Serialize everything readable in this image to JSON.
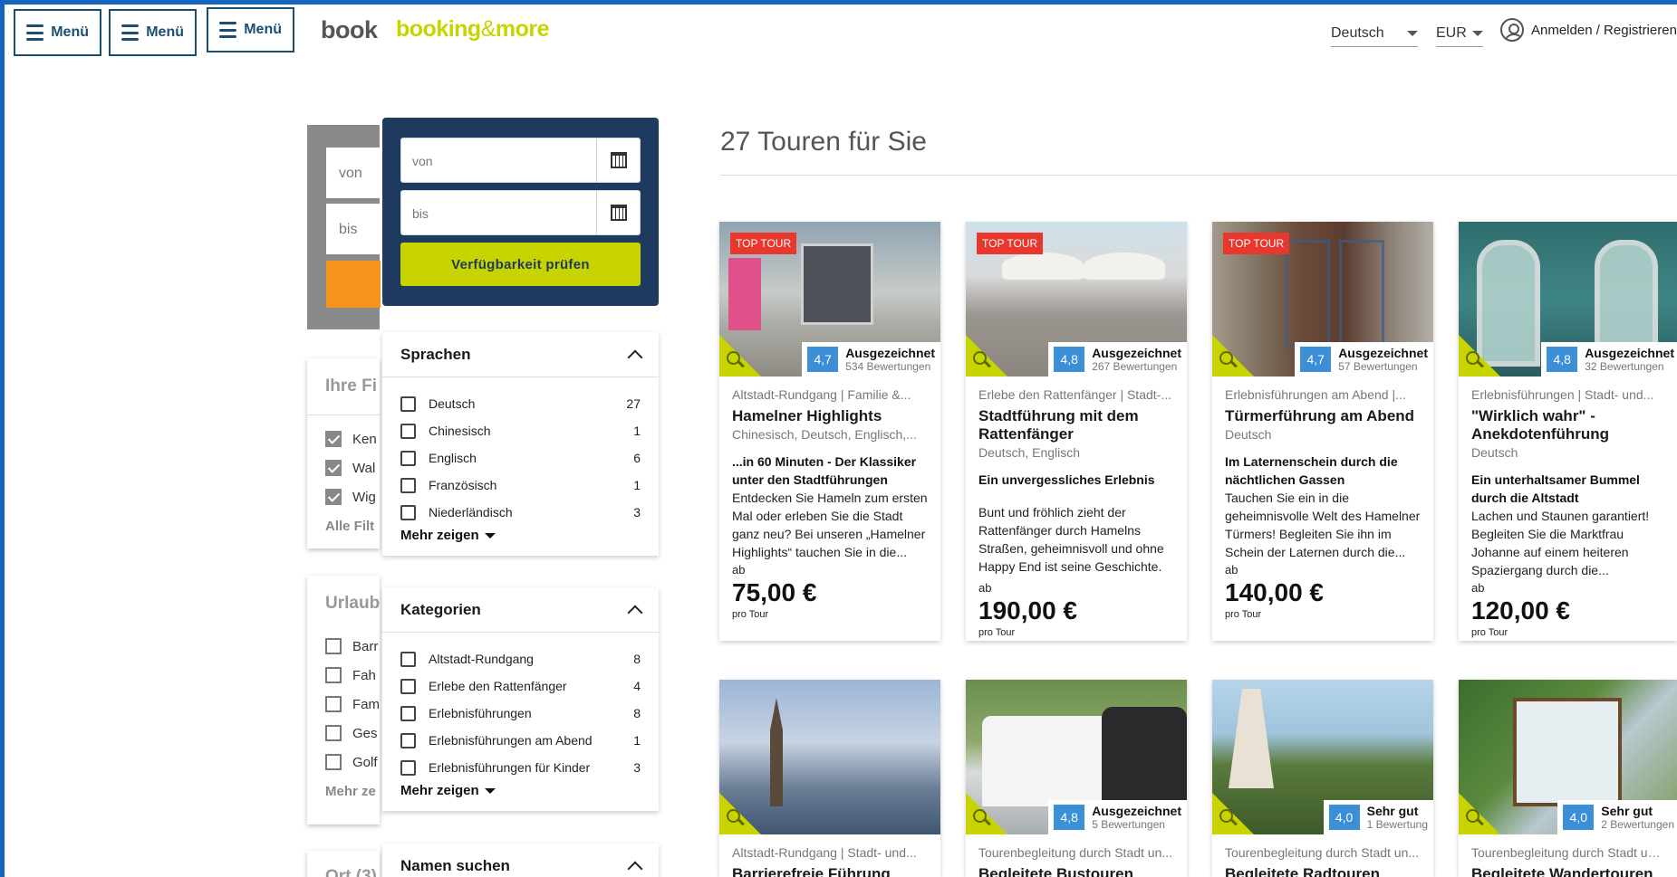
{
  "header": {
    "menu_label": "Menü",
    "logo_behind": "booki",
    "logo_main": "booking",
    "logo_amp": "&",
    "logo_end": "more",
    "language": "Deutsch",
    "currency": "EUR",
    "account": "Anmelden / Registrieren"
  },
  "bg_panel": {
    "from": "von",
    "to": "bis",
    "filters_title": "Ihre Fi",
    "checked": [
      "Ken",
      "Wal",
      "Wig"
    ],
    "all_filters": "Alle Filt",
    "holiday_title": "Urlaub",
    "holiday_items": [
      "Barr",
      "Fah",
      "Fam",
      "Ges",
      "Golf"
    ],
    "more": "Mehr ze",
    "place_title": "Ort (3)"
  },
  "availability": {
    "from_placeholder": "von",
    "to_placeholder": "bis",
    "check_button": "Verfügbarkeit prüfen"
  },
  "filters": {
    "languages": {
      "title": "Sprachen",
      "items": [
        {
          "label": "Deutsch",
          "count": "27"
        },
        {
          "label": "Chinesisch",
          "count": "1"
        },
        {
          "label": "Englisch",
          "count": "6"
        },
        {
          "label": "Französisch",
          "count": "1"
        },
        {
          "label": "Niederländisch",
          "count": "3"
        }
      ],
      "more": "Mehr zeigen"
    },
    "categories": {
      "title": "Kategorien",
      "items": [
        {
          "label": "Altstadt-Rundgang",
          "count": "8"
        },
        {
          "label": "Erlebe den Rattenfänger",
          "count": "4"
        },
        {
          "label": "Erlebnisführungen",
          "count": "8"
        },
        {
          "label": "Erlebnisführungen am Abend",
          "count": "1"
        },
        {
          "label": "Erlebnisführungen für Kinder",
          "count": "3"
        }
      ],
      "more": "Mehr zeigen"
    },
    "name_search": {
      "title": "Namen suchen"
    }
  },
  "results": {
    "title": "27 Touren für Sie",
    "tours": [
      {
        "top": "TOP TOUR",
        "rating": "4,7",
        "rating_label": "Ausgezeichnet",
        "reviews": "534 Bewertungen",
        "category": "Altstadt-Rundgang | Familie &...",
        "title": "Hamelner Highlights",
        "languages": "Chinesisch, Deutsch, Englisch,...",
        "desc_bold": "...in 60 Minuten - Der Klassiker unter den Stadtführungen",
        "desc": "Entdecken Sie Hameln zum ersten Mal oder erleben Sie die Stadt ganz neu? Bei unseren „Hamelner Highlights“ tauchen Sie in die...",
        "from": "ab",
        "price": "75,00 €",
        "per": "pro Tour"
      },
      {
        "top": "TOP TOUR",
        "rating": "4,8",
        "rating_label": "Ausgezeichnet",
        "reviews": "267 Bewertungen",
        "category": "Erlebe den Rattenfänger | Stadt-...",
        "title": "Stadtführung mit dem Rattenfänger",
        "languages": "Deutsch, Englisch",
        "desc_bold": "Ein unvergessliches Erlebnis",
        "desc": "Bunt und fröhlich zieht der Rattenfänger durch Hamelns Straßen, geheimnisvoll und ohne Happy End ist seine Geschichte.",
        "from": "ab",
        "price": "190,00 €",
        "per": "pro Tour"
      },
      {
        "top": "TOP TOUR",
        "rating": "4,7",
        "rating_label": "Ausgezeichnet",
        "reviews": "57 Bewertungen",
        "category": "Erlebnisführungen am Abend |...",
        "title": "Türmerführung am Abend",
        "languages": "Deutsch",
        "desc_bold": "Im Laternenschein durch die nächtlichen Gassen",
        "desc": "Tauchen Sie ein in die geheimnisvolle Welt des Hamelner Türmers! Begleiten Sie ihn im Schein der Laternen durch die...",
        "from": "ab",
        "price": "140,00 €",
        "per": "pro Tour"
      },
      {
        "top": "",
        "rating": "4,8",
        "rating_label": "Ausgezeichnet",
        "reviews": "32 Bewertungen",
        "category": "Erlebnisführungen | Stadt- und...",
        "title": "\"Wirklich wahr\" - Anekdotenführung",
        "languages": "Deutsch",
        "desc_bold": "Ein unterhaltsamer Bummel durch die Altstadt",
        "desc": "Lachen und Staunen garantiert! Begleiten Sie die Marktfrau Johanne auf einem heiteren Spaziergang durch die...",
        "from": "ab",
        "price": "120,00 €",
        "per": "pro Tour"
      },
      {
        "rating": "",
        "rating_label": "",
        "reviews": "",
        "category": "Altstadt-Rundgang | Stadt- und...",
        "title": "Barrierefreie Führung"
      },
      {
        "rating": "4,8",
        "rating_label": "Ausgezeichnet",
        "reviews": "5 Bewertungen",
        "category": "Tourenbegleitung durch Stadt un...",
        "title": "Begleitete Bustouren"
      },
      {
        "rating": "4,0",
        "rating_label": "Sehr gut",
        "reviews": "1 Bewertung",
        "category": "Tourenbegleitung durch Stadt un...",
        "title": "Begleitete Radtouren"
      },
      {
        "rating": "4,0",
        "rating_label": "Sehr gut",
        "reviews": "2 Bewertungen",
        "category": "Tourenbegleitung durch Stadt un...",
        "title": "Begleitete Wandertouren"
      }
    ]
  }
}
